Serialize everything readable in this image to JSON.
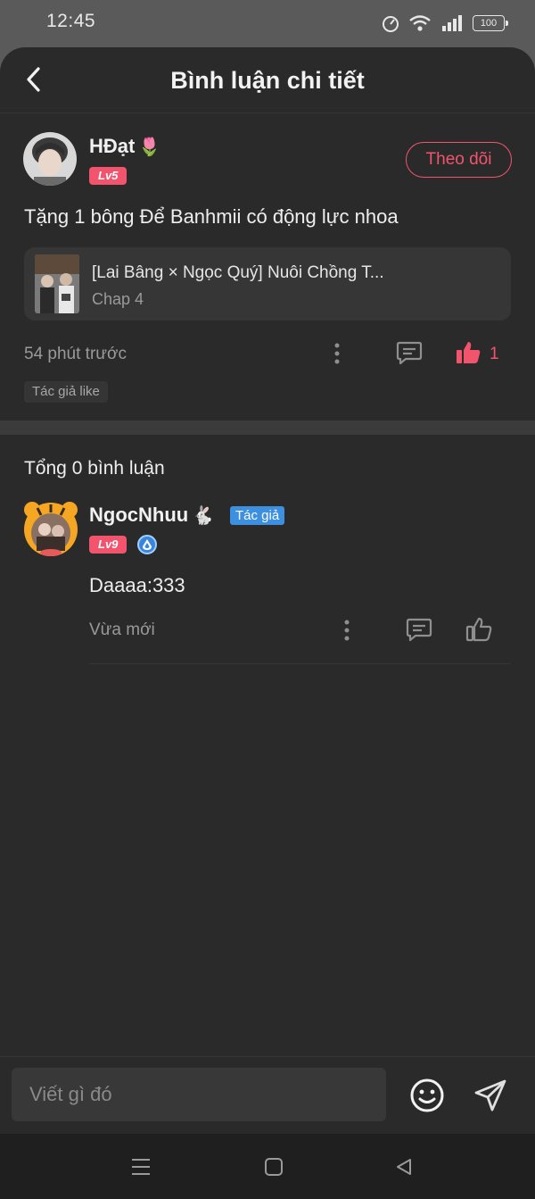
{
  "status": {
    "time": "12:45",
    "battery": "100"
  },
  "header": {
    "title": "Bình luận chi tiết"
  },
  "post": {
    "user_name": "HĐạt",
    "name_emoji": "🌷",
    "level": "Lv5",
    "follow_label": "Theo dõi",
    "text": "Tặng 1 bông Để Banhmii có động lực nhoa",
    "chapter": {
      "title": "[Lai Bâng × Ngọc Quý] Nuôi Chồng T...",
      "subtitle": "Chap 4"
    },
    "time": "54 phút trước",
    "like_count": "1",
    "author_like": "Tác giả like"
  },
  "replies": {
    "total_label": "Tổng 0 bình luận",
    "items": [
      {
        "user_name": "NgocNhuu",
        "name_emoji": "🐇",
        "author_tag": "Tác giả",
        "level": "Lv9",
        "text": "Daaaa:333",
        "time": "Vừa mới"
      }
    ]
  },
  "composer": {
    "placeholder": "Viết gì đó"
  },
  "colors": {
    "accent": "#f2546e",
    "background": "#2a2a2a",
    "author_tag": "#3d8fe0"
  }
}
